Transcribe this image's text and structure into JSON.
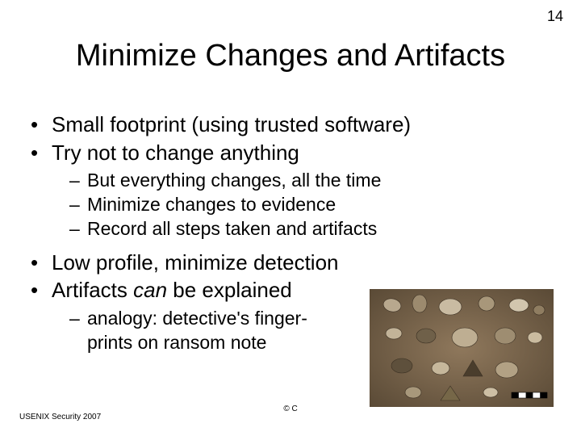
{
  "page_number": "14",
  "title": "Minimize Changes and Artifacts",
  "bullets": {
    "b1": "Small footprint (using trusted software)",
    "b2": "Try not to change anything",
    "b2_subs": {
      "s1": "But everything changes, all the time",
      "s2": "Minimize changes to evidence",
      "s3": "Record all steps taken and artifacts"
    },
    "b3": "Low profile, minimize detection",
    "b4_pre": "Artifacts ",
    "b4_em": "can",
    "b4_post": " be explained",
    "b4_subs": {
      "s1": "analogy: detective's finger-\nprints on ransom note"
    }
  },
  "footer": {
    "left": "USENIX Security 2007",
    "center": "© C"
  },
  "image": {
    "name": "stone-artifacts-photo"
  }
}
